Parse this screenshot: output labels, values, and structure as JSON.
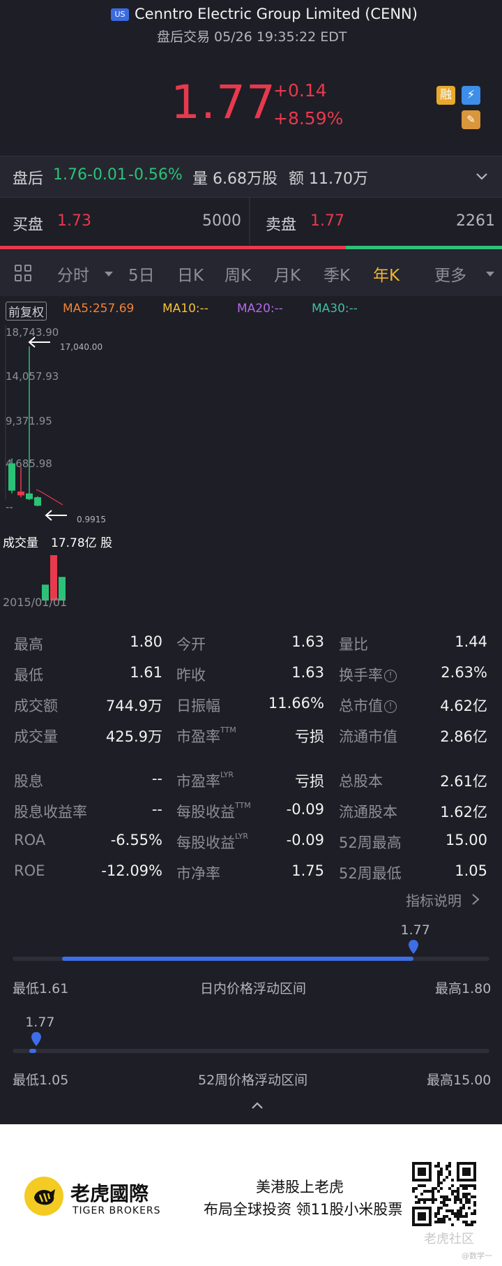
{
  "header": {
    "badge": "US",
    "title": "Cenntro Electric Group Limited (CENN)",
    "subtitle": "盘后交易 05/26 19:35:22 EDT",
    "price": "1.77",
    "change": "+0.14",
    "change_pct": "+8.59%",
    "icon_rong": "融",
    "icon_flash": "⚡",
    "icon_cap": "✎"
  },
  "after_hours": {
    "label": "盘后",
    "price": "1.76",
    "change": "-0.01",
    "change_pct": "-0.56%",
    "vol_label": "量",
    "vol": "6.68万股",
    "amt_label": "额",
    "amt": "11.70万"
  },
  "bid_ask": {
    "bid_label": "买盘",
    "bid_price": "1.73",
    "bid_size": "5000",
    "ask_label": "卖盘",
    "ask_price": "1.77",
    "ask_size": "2261",
    "bid_ratio": 0.689
  },
  "tabs": {
    "items": [
      "分时",
      "5日",
      "日K",
      "周K",
      "月K",
      "季K",
      "年K",
      "更多"
    ],
    "active": "年K"
  },
  "chart": {
    "adjust_btn": "前复权",
    "ma5": "MA5:257.69",
    "ma10": "MA10:--",
    "ma20": "MA20:--",
    "ma30": "MA30:--",
    "y_ticks": [
      "18,743.90",
      "14,057.93",
      "9,371.95",
      "4,685.98",
      "--"
    ],
    "high_marker": "17,040.00",
    "low_marker": "0.9915",
    "volume_label": "成交量",
    "volume_value": "17.78亿 股",
    "start_date": "2015/01/01"
  },
  "chart_data": {
    "type": "bar",
    "title": "",
    "ylim": [
      0,
      18743.9
    ],
    "candles": [
      {
        "open": 4685.98,
        "close": 1800,
        "high": 5200,
        "low": 1500,
        "up": false
      },
      {
        "open": 1700,
        "close": 1300,
        "high": 4300,
        "low": 1100,
        "up": true
      },
      {
        "open": 1500,
        "close": 900,
        "high": 17040,
        "low": 800,
        "up": false
      },
      {
        "open": 1100,
        "close": 200,
        "high": 1200,
        "low": 150,
        "up": false
      }
    ],
    "volume": [
      0.35,
      1.0,
      0.52
    ]
  },
  "stats": {
    "col1": [
      {
        "label": "最高",
        "value": "1.80"
      },
      {
        "label": "最低",
        "value": "1.61"
      },
      {
        "label": "成交额",
        "value": "744.9万"
      },
      {
        "label": "成交量",
        "value": "425.9万"
      },
      {
        "label": "股息",
        "value": "--"
      },
      {
        "label": "股息收益率",
        "value": "--"
      },
      {
        "label": "ROA",
        "value": "-6.55%"
      },
      {
        "label": "ROE",
        "value": "-12.09%"
      }
    ],
    "col2": [
      {
        "label": "今开",
        "sup": "",
        "value": "1.63"
      },
      {
        "label": "昨收",
        "sup": "",
        "value": "1.63"
      },
      {
        "label": "日振幅",
        "sup": "",
        "value": "11.66%"
      },
      {
        "label": "市盈率",
        "sup": "TTM",
        "value": "亏损"
      },
      {
        "label": "市盈率",
        "sup": "LYR",
        "value": "亏损"
      },
      {
        "label": "每股收益",
        "sup": "TTM",
        "value": "-0.09"
      },
      {
        "label": "每股收益",
        "sup": "LYR",
        "value": "-0.09"
      },
      {
        "label": "市净率",
        "sup": "",
        "value": "1.75"
      }
    ],
    "col3": [
      {
        "label": "量比",
        "value": "1.44"
      },
      {
        "label": "换手率",
        "value": "2.63%"
      },
      {
        "label": "总市值",
        "value": "4.62亿"
      },
      {
        "label": "流通市值",
        "value": "2.86亿"
      },
      {
        "label": "总股本",
        "value": "2.61亿"
      },
      {
        "label": "流通股本",
        "value": "1.62亿"
      },
      {
        "label": "52周最高",
        "value": "15.00"
      },
      {
        "label": "52周最低",
        "value": "1.05"
      }
    ],
    "info_icon": "!",
    "explain_link": "指标说明"
  },
  "day_range": {
    "current": "1.77",
    "low": "最低1.61",
    "title": "日内价格浮动区间",
    "high": "最高1.80",
    "position": 0.84
  },
  "week52_range": {
    "current": "1.77",
    "low": "最低1.05",
    "title": "52周价格浮动区间",
    "high": "最高15.00",
    "position": 0.05
  },
  "footer": {
    "brand_cn": "老虎國際",
    "brand_en": "TIGER BROKERS",
    "slogan1": "美港股上老虎",
    "slogan2": "布局全球投资 领11股小米股票",
    "watermark": "老虎社区",
    "watermark_user": "@数学一"
  },
  "colors": {
    "red": "#e8394d",
    "green": "#2bc277",
    "accent": "#3e6ee6",
    "bg": "#1e1e26"
  }
}
